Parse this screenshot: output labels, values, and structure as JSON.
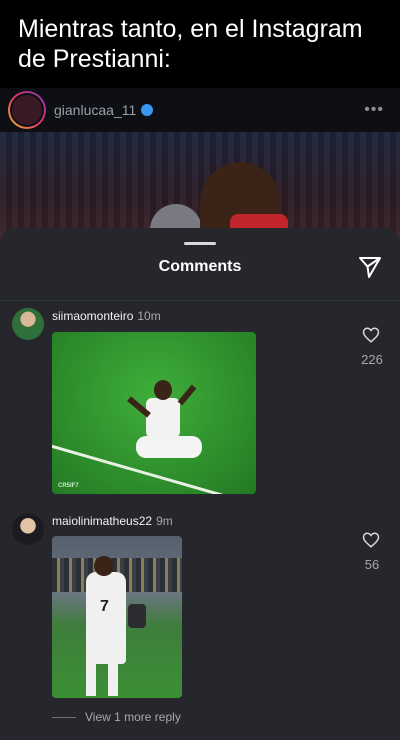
{
  "caption": {
    "line1": "Mientras tanto, en el Instagram",
    "line2": "de Prestianni:"
  },
  "post": {
    "username": "gianlucaa_11",
    "verified": true,
    "more_label": "•••"
  },
  "comments_sheet": {
    "title": "Comments",
    "comments": [
      {
        "username": "siimaomonteiro",
        "time": "10m",
        "likes": "226",
        "media_watermark": "CR5IF7"
      },
      {
        "username": "maiolinimatheus22",
        "time": "9m",
        "likes": "56",
        "jersey_number": "7"
      }
    ],
    "view_replies": "View 1 more reply"
  },
  "colors": {
    "sheet_bg": "#25272d",
    "caption_bg": "#000000",
    "verified_blue": "#3897f0",
    "muted_text": "#a8a8a8"
  },
  "icons": [
    "more-icon",
    "verified-icon",
    "send-icon",
    "heart-icon"
  ]
}
